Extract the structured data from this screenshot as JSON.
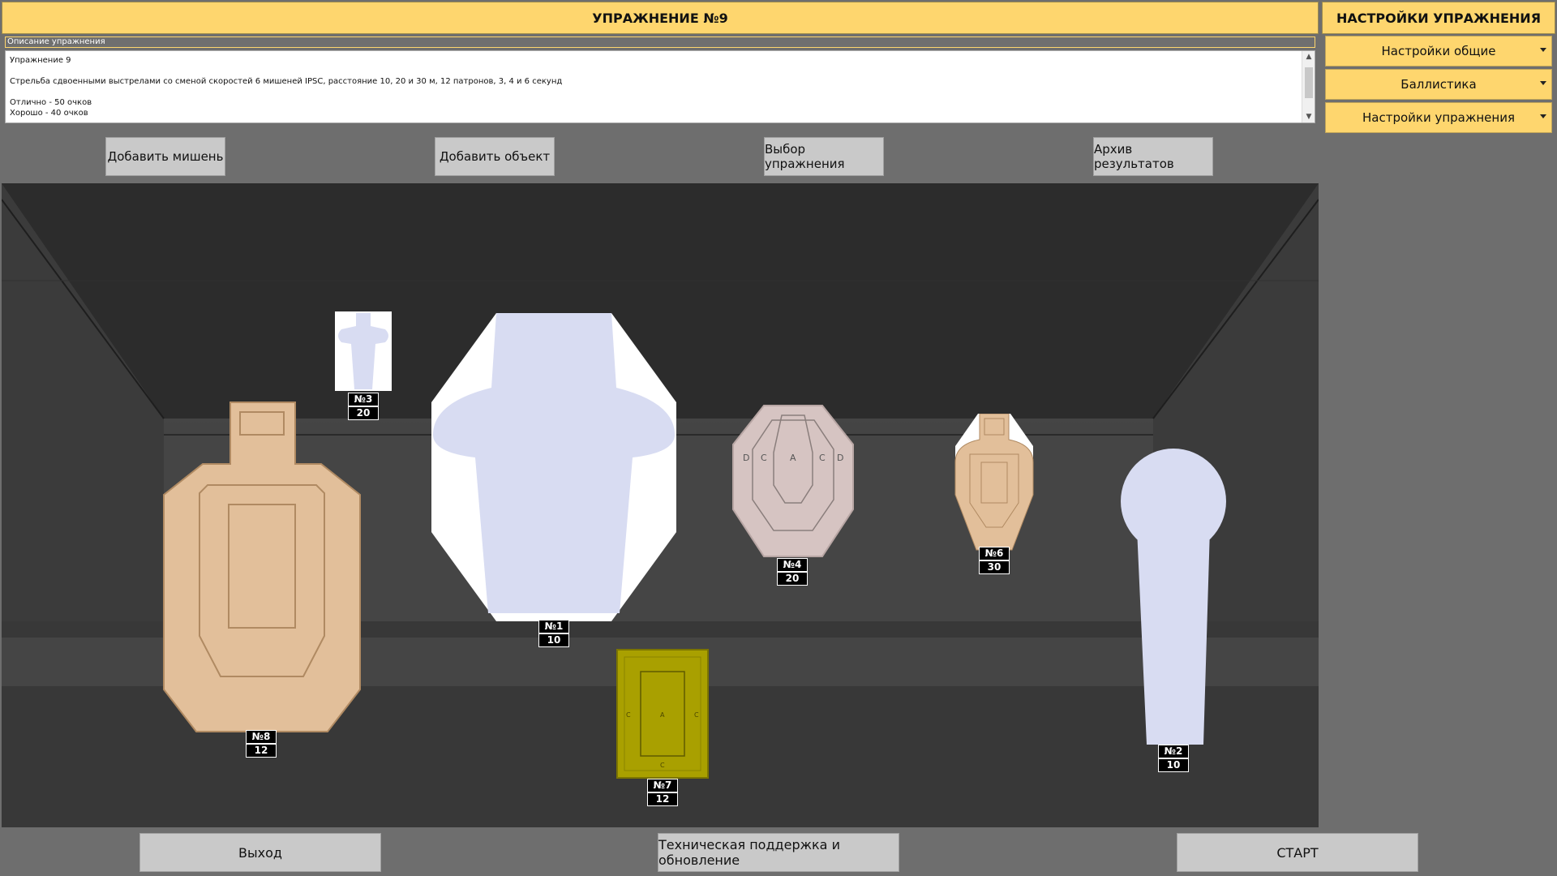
{
  "header": {
    "title": "УПРАЖНЕНИЕ №9"
  },
  "description": {
    "label": "Описание упражнения",
    "text": "Упражнение 9\n\nСтрельба сдвоенными выстрелами со сменой скоростей 6 мишеней IPSC, расстояние 10, 20 и 30 м, 12 патронов, 3, 4 и 6 секунд\n\nОтлично - 50 очков\nХорошо - 40 очков"
  },
  "actions": {
    "add_target": "Добавить мишень",
    "add_object": "Добавить объект",
    "choose_exercise": "Выбор упражнения",
    "results_archive": "Архив результатов"
  },
  "side": {
    "title": "НАСТРОЙКИ УПРАЖНЕНИЯ",
    "items": [
      "Настройки общие",
      "Баллистика",
      "Настройки упражнения"
    ]
  },
  "bottom": {
    "exit": "Выход",
    "support": "Техническая поддержка и обновление",
    "start": "СТАРТ"
  },
  "targets": [
    {
      "number": "№3",
      "distance": "20"
    },
    {
      "number": "№1",
      "distance": "10"
    },
    {
      "number": "№4",
      "distance": "20"
    },
    {
      "number": "№6",
      "distance": "30"
    },
    {
      "number": "№8",
      "distance": "12"
    },
    {
      "number": "№7",
      "distance": "12"
    },
    {
      "number": "№2",
      "distance": "10"
    }
  ],
  "zone_letters": {
    "a": "A",
    "c": "C",
    "d": "D"
  },
  "colors": {
    "accent": "#fed66e",
    "target_tan": "#e2bf9a",
    "target_lavender": "#d8dcf2",
    "target_taupe": "#d6c4c2",
    "target_olive": "#a9a000"
  }
}
